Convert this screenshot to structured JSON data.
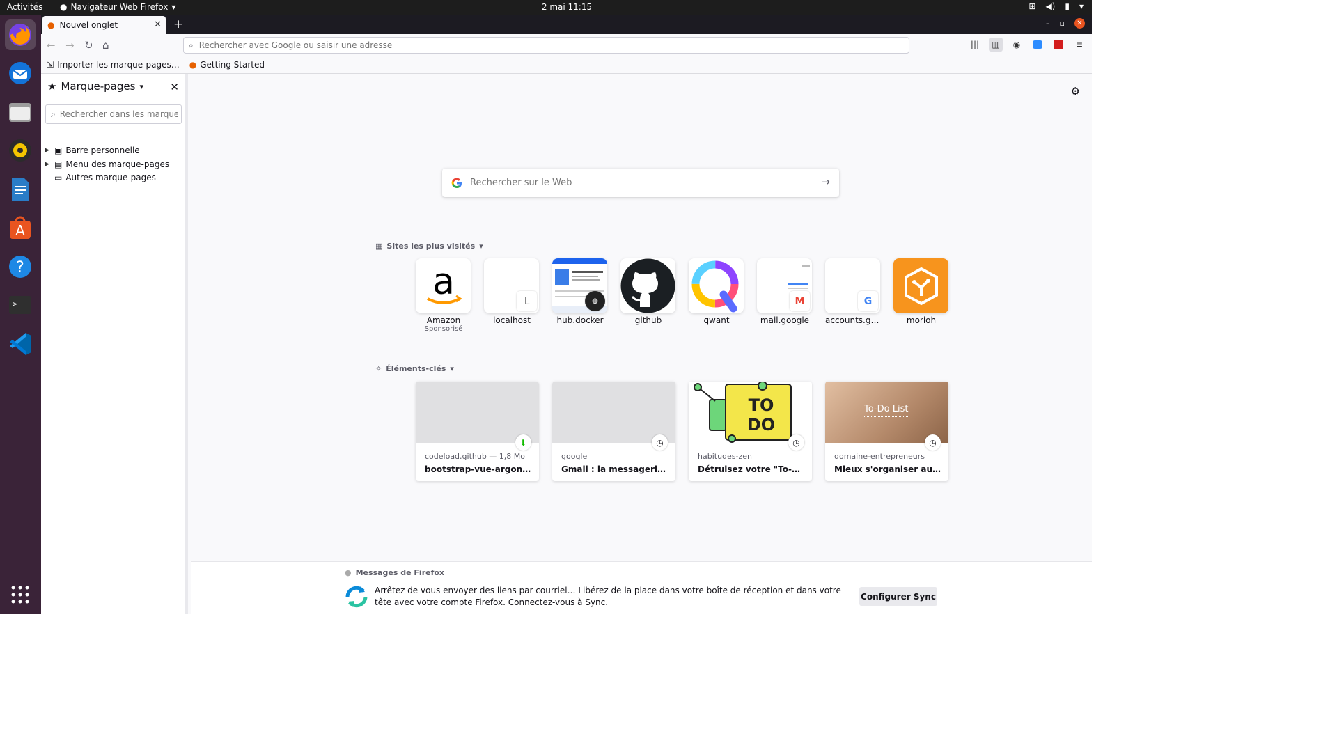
{
  "topbar": {
    "activities": "Activités",
    "app": "Navigateur Web Firefox",
    "clock": "2 mai  11:15"
  },
  "tab": {
    "title": "Nouvel onglet"
  },
  "urlbar": {
    "placeholder": "Rechercher avec Google ou saisir une adresse"
  },
  "bookmarks_bar": [
    {
      "label": "Importer les marque-pages…"
    },
    {
      "label": "Getting Started"
    }
  ],
  "sidebar": {
    "title": "Marque-pages",
    "search_placeholder": "Rechercher dans les marque-p",
    "items": [
      {
        "label": "Barre personnelle"
      },
      {
        "label": "Menu des marque-pages"
      },
      {
        "label": "Autres marque-pages"
      }
    ]
  },
  "newtab": {
    "search_placeholder": "Rechercher sur le Web",
    "topsites_title": "Sites les plus visités",
    "topsites": [
      {
        "label": "Amazon",
        "sub": "Sponsorisé"
      },
      {
        "label": "localhost",
        "letter": "L"
      },
      {
        "label": "hub.docker"
      },
      {
        "label": "github"
      },
      {
        "label": "qwant"
      },
      {
        "label": "mail.google",
        "letter": "M"
      },
      {
        "label": "accounts.go...",
        "letter": "G"
      },
      {
        "label": "morioh"
      }
    ],
    "highlights_title": "Éléments-clés",
    "highlights": [
      {
        "source": "codeload.github — 1,8 Mo",
        "title": "bootstrap-vue-argon-das..."
      },
      {
        "source": "google",
        "title": "Gmail : la messagerie de ..."
      },
      {
        "source": "habitudes-zen",
        "title": "Détruisez votre \"To-do li...",
        "art": "TO DO"
      },
      {
        "source": "domaine-entrepreneurs",
        "title": "Mieux s'organiser au Quo...",
        "art": "To-Do List"
      }
    ]
  },
  "message": {
    "title": "Messages de Firefox",
    "body": "Arrêtez de vous envoyer des liens par courriel… Libérez de la place dans votre boîte de réception et dans votre tête avec votre compte Firefox. Connectez-vous à Sync.",
    "button": "Configurer Sync"
  },
  "colors": {
    "accent": "#e95420",
    "dock": "#3a2338",
    "download": "#2ac3a2"
  }
}
